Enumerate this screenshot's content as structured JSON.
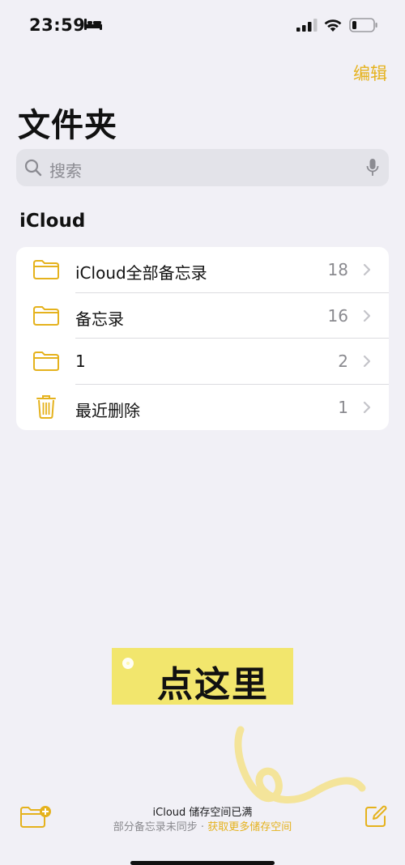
{
  "status_bar": {
    "time": "23:59",
    "icons": [
      "bed-icon",
      "signal-icon",
      "wifi-icon",
      "battery-icon"
    ]
  },
  "header": {
    "edit_label": "编辑",
    "title": "文件夹"
  },
  "search": {
    "placeholder": "搜索",
    "icons": [
      "search-icon",
      "mic-icon"
    ]
  },
  "section": {
    "title": "iCloud",
    "folders": [
      {
        "label": "iCloud全部备忘录",
        "count": "18",
        "icon": "folder-icon"
      },
      {
        "label": "备忘录",
        "count": "16",
        "icon": "folder-icon"
      },
      {
        "label": "1",
        "count": "2",
        "icon": "folder-icon"
      },
      {
        "label": "最近删除",
        "count": "1",
        "icon": "trash-icon"
      }
    ]
  },
  "overlay": {
    "tag_text": "点这里"
  },
  "footer": {
    "storage_title": "iCloud 储存空间已满",
    "storage_status": "部分备忘录未同步",
    "separator": " · ",
    "storage_link": "获取更多储存空间",
    "icons": [
      "new-folder-icon",
      "compose-icon"
    ]
  },
  "colors": {
    "accent": "#e5b21d",
    "background": "#f1f0f6",
    "tag": "#f2e66d"
  }
}
